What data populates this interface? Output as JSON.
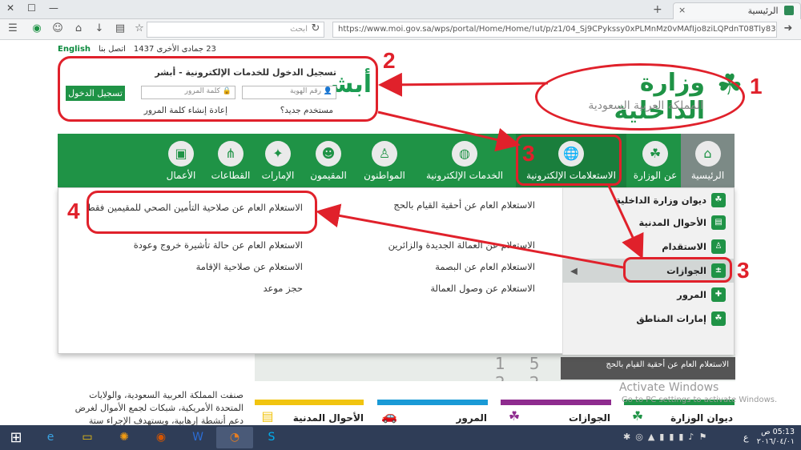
{
  "browser": {
    "tab_title": "الرئيسية",
    "search_placeholder": "ابحث",
    "url": "https://www.moi.gov.sa/wps/portal/Home/Home/!ut/p/z1/04_Sj9CPykssy0xPLMnMz0vMAfIjo8ziLQPdnT08Tly83Q0dzQwcPc2N_A08"
  },
  "top_strip": {
    "english": "English",
    "contact": "اتصل بنا",
    "date": "23 جمادى الأخرى 1437"
  },
  "login": {
    "title": "تسجيل الدخول للخدمات الإلكترونية - أبشر",
    "logo_text": "أبشر",
    "id_placeholder": "رقم الهوية",
    "password_placeholder": "كلمة المرور",
    "login_button": "تسجيل الدخول",
    "new_user": "مستخدم جديد؟",
    "reset_password": "إعادة إنشاء كلمة المرور"
  },
  "logo": {
    "name": "وزارة الداخلية",
    "subtitle": "المملكة العربية السعودية"
  },
  "nav": [
    {
      "label": "الرئيسية",
      "icon": "home-icon"
    },
    {
      "label": "عن الوزارة",
      "icon": "emblem-icon"
    },
    {
      "label": "الاستعلامات الإلكترونية",
      "icon": "globe-hand-icon"
    },
    {
      "label": "الخدمات الإلكترونية",
      "icon": "globe-icon"
    },
    {
      "label": "المواطنون",
      "icon": "citizen-icon"
    },
    {
      "label": "المقيمون",
      "icon": "residents-icon"
    },
    {
      "label": "الإمارات",
      "icon": "map-icon"
    },
    {
      "label": "القطاعات",
      "icon": "network-icon"
    },
    {
      "label": "الأعمال",
      "icon": "briefcase-icon"
    }
  ],
  "side_menu": [
    {
      "label": "ديوان وزارة الداخلية"
    },
    {
      "label": "الأحوال المدنية"
    },
    {
      "label": "الاستقدام"
    },
    {
      "label": "الجوازات"
    },
    {
      "label": "المرور"
    },
    {
      "label": "إمارات المناطق"
    }
  ],
  "queries": {
    "col1": [
      "الاستعلام العام عن أحقية القيام بالحج",
      "الاستعلام عن العمالة الجديدة والزائرين",
      "الاستعلام العام عن البصمة",
      "الاستعلام عن وصول العمالة"
    ],
    "col2": [
      "الاستعلام العام عن صلاحية التأمين الصحي للمقيمين فقط",
      "الاستعلام العام عن حالة تأشيرة خروج وعودة",
      "الاستعلام عن صلاحية الإقامة",
      "حجز موعد"
    ]
  },
  "background": {
    "banner_caption": "الاستعلام العام عن أحقية القيام بالحج",
    "calendar_digits": "15 22",
    "paragraph": "صنفت المملكة العربية السعودية، والولايات المتحدة الأمريكية، شبكات لجمع الأموال لغرض دعم أنشطة إرهابية، ويستهدف الإجراء ستة",
    "categories": [
      "ديوان الوزارة",
      "الجوازات",
      "المرور",
      "الأحوال المدنية"
    ],
    "colors": [
      "#1f9346",
      "#8e2b8e",
      "#1a9ad6",
      "#f1c40f"
    ]
  },
  "watermark": {
    "title": "Activate Windows",
    "subtitle": "Go to PC settings to activate Windows."
  },
  "annotations": [
    "1",
    "2",
    "3",
    "3",
    "4"
  ],
  "taskbar": {
    "time": "05:13 ص",
    "date": "٢٠١٦/٠٤/٠١",
    "lang": "ع"
  }
}
